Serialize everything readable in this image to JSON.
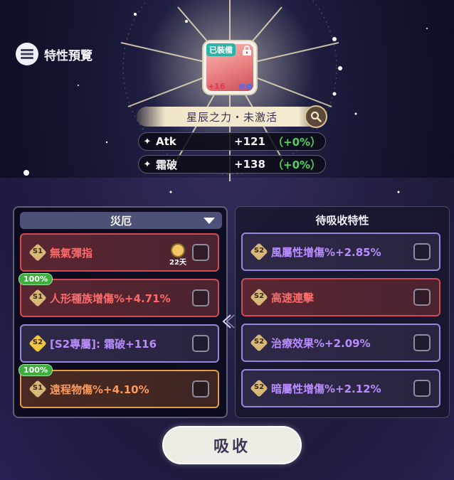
{
  "preview": {
    "label": "特性預覽",
    "icon": "list-icon"
  },
  "equipment": {
    "tag": "已裝備",
    "level": "+16",
    "lock_icon": "lock-icon"
  },
  "set": {
    "name": "星辰之力・未激活",
    "search_icon": "search-icon"
  },
  "stats": [
    {
      "name": "Atk",
      "value": "+121",
      "percent": "（+0%）"
    },
    {
      "name": "霜破",
      "value": "+138",
      "percent": "（+0%）"
    }
  ],
  "left_panel": {
    "title": "災厄",
    "items": [
      {
        "badge": "S1",
        "text": "無氣彈指",
        "style": "red",
        "timer": "22天"
      },
      {
        "badge": "S1",
        "text": "人形種族增傷%+4.71%",
        "style": "red",
        "progress": "100%"
      },
      {
        "badge": "S2",
        "text": "[S2專屬]: 霜破+116",
        "style": "purple"
      },
      {
        "badge": "S1",
        "text": "遠程物傷%+4.10%",
        "style": "orange",
        "progress": "100%"
      }
    ]
  },
  "right_panel": {
    "title": "待吸收特性",
    "items": [
      {
        "badge": "S2",
        "text": "風屬性增傷%+2.85%",
        "style": "purple"
      },
      {
        "badge": "S2",
        "text": "高速連擊",
        "style": "red"
      },
      {
        "badge": "S2",
        "text": "治療效果%+2.09%",
        "style": "purple"
      },
      {
        "badge": "S2",
        "text": "暗屬性增傷%+2.12%",
        "style": "purple"
      }
    ]
  },
  "absorb_button": {
    "label": "吸收"
  },
  "colors": {
    "red": "#d24a55",
    "purple": "#9a86d6",
    "orange": "#e49a4a",
    "green": "#4fd060"
  }
}
